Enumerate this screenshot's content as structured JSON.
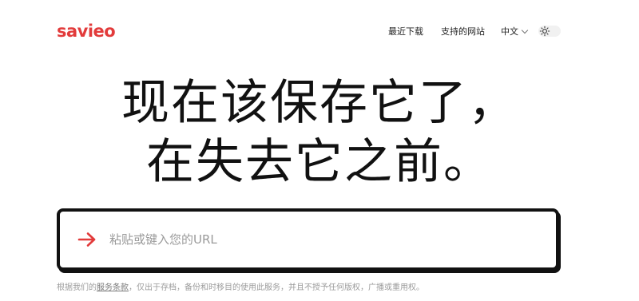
{
  "header": {
    "logo_text": "savieo",
    "nav": {
      "recent_downloads": "最近下载",
      "supported_sites": "支持的网站",
      "language": "中文"
    },
    "theme_toggle_icon": "sun-icon"
  },
  "hero": {
    "line1": "现在该保存它了，",
    "line2": "在失去它之前。"
  },
  "url_input": {
    "value": "",
    "placeholder": "粘贴或键入您的URL",
    "icon": "arrow-right-icon"
  },
  "terms": {
    "prefix": "根据我们的",
    "link": "服务条款",
    "suffix": "，仅出于存档，备份和时移目的使用此服务，并且不授予任何版权，广播或重用权。"
  },
  "colors": {
    "brand": "#e23b3b",
    "text": "#111111",
    "muted": "#9b9b9b"
  }
}
